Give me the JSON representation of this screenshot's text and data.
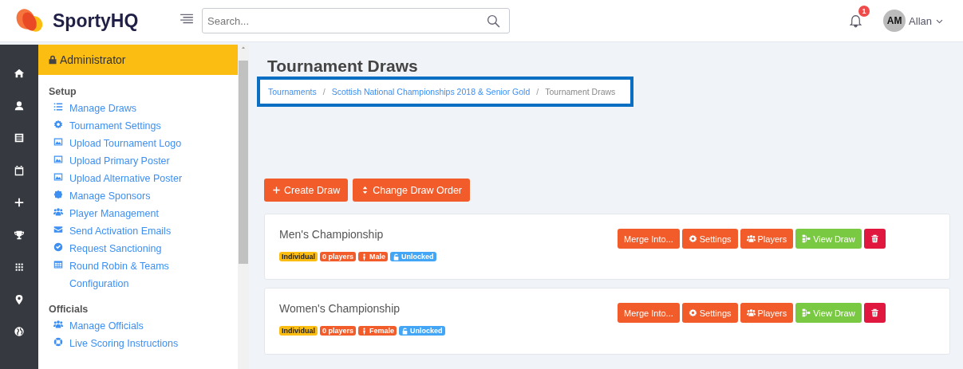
{
  "header": {
    "brand": "SportyHQ",
    "search": {
      "placeholder": "Search..."
    },
    "notifications": "1",
    "user": {
      "initials": "AM",
      "name": "Allan"
    }
  },
  "sidebar": {
    "title": "Administrator",
    "sections": [
      {
        "heading": "Setup",
        "items": [
          "Manage Draws",
          "Tournament Settings",
          "Upload Tournament Logo",
          "Upload Primary Poster",
          "Upload Alternative Poster",
          "Manage Sponsors",
          "Player Management",
          "Send Activation Emails",
          "Request Sanctioning",
          "Round Robin & Teams Configuration"
        ]
      },
      {
        "heading": "Officials",
        "items": [
          "Manage Officials",
          "Live Scoring Instructions"
        ]
      }
    ]
  },
  "page": {
    "title": "Tournament Draws",
    "breadcrumb": [
      {
        "label": "Tournaments",
        "link": true
      },
      {
        "separator": "/",
        "label": "Scottish National Championships 2018 & Senior Gold",
        "link": true
      },
      {
        "separator": "/",
        "label": "Tournament Draws",
        "link": false
      }
    ],
    "actions": [
      {
        "label": "Create Draw",
        "kind": "create"
      },
      {
        "label": "Change Draw Order",
        "kind": "order"
      }
    ],
    "draws": [
      {
        "name": "Men's Championship",
        "badges": [
          {
            "label": "Individual",
            "kind": "text",
            "color": "#fbbd12"
          },
          {
            "label": "0 players",
            "kind": "text",
            "color": "#f25c2a"
          },
          {
            "label": "Male",
            "kind": "gender",
            "color": "#f25c2a"
          },
          {
            "label": "Unlocked",
            "kind": "lock",
            "color": "#42a5f5"
          }
        ],
        "buttons": [
          {
            "label": "Merge Into...",
            "kind": "merge"
          },
          {
            "label": "Settings",
            "kind": "settings"
          },
          {
            "label": "Players",
            "kind": "players"
          },
          {
            "label": "View Draw",
            "kind": "view"
          },
          {
            "kind": "delete"
          }
        ]
      },
      {
        "name": "Women's Championship",
        "badges": [
          {
            "label": "Individual",
            "kind": "text",
            "color": "#fbbd12"
          },
          {
            "label": "0 players",
            "kind": "text",
            "color": "#f25c2a"
          },
          {
            "label": "Female",
            "kind": "gender",
            "color": "#f25c2a"
          },
          {
            "label": "Unlocked",
            "kind": "lock",
            "color": "#42a5f5"
          }
        ],
        "buttons": [
          {
            "label": "Merge Into...",
            "kind": "merge"
          },
          {
            "label": "Settings",
            "kind": "settings"
          },
          {
            "label": "Players",
            "kind": "players"
          },
          {
            "label": "View Draw",
            "kind": "view"
          },
          {
            "kind": "delete"
          }
        ]
      }
    ]
  }
}
